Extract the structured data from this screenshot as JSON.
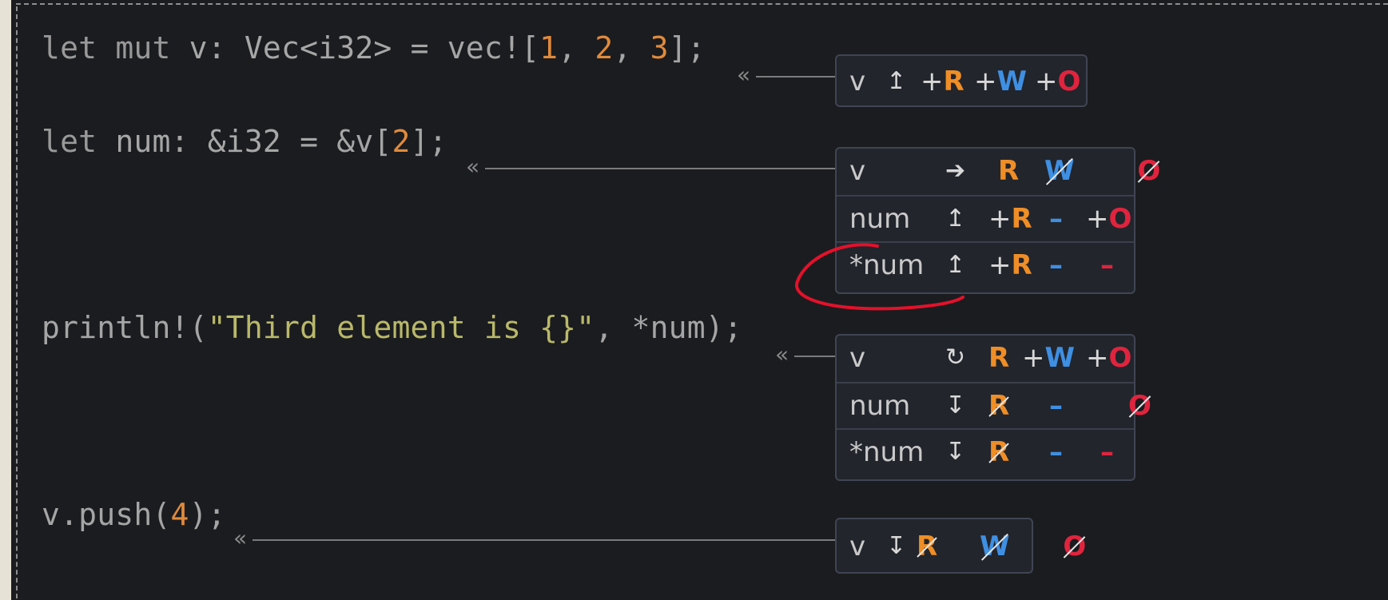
{
  "code": {
    "line1": {
      "kw1": "let",
      "kw2": "mut",
      "name": "v",
      "colon": ":",
      "type": "Vec<i32>",
      "eq": "=",
      "call": "vec!",
      "open": "[",
      "n1": "1",
      "c1": ",",
      "n2": "2",
      "c2": ",",
      "n3": "3",
      "close": "];"
    },
    "line2": {
      "kw1": "let",
      "name": "num",
      "colon": ":",
      "type": "&i32",
      "eq": "=",
      "expr_pre": "&v[",
      "idx": "2",
      "expr_post": "];"
    },
    "line3": {
      "call": "println!(",
      "str": "\"Third element is {}\"",
      "rest": ", *num);"
    },
    "line4": {
      "pre": "v.push(",
      "arg": "4",
      "post": ");"
    }
  },
  "permission_boxes": [
    {
      "rows": [
        {
          "path": "v",
          "action": "↥",
          "r": "+R",
          "w": "+W",
          "o": "+O"
        }
      ]
    },
    {
      "rows": [
        {
          "path": "v",
          "action": "➔",
          "r": "R",
          "w": "W",
          "o": "O"
        },
        {
          "path": "num",
          "action": "↥",
          "r": "+R",
          "w": "–",
          "o": "+O"
        },
        {
          "path": "*num",
          "action": "↥",
          "r": "+R",
          "w": "–",
          "o": "–"
        }
      ]
    },
    {
      "rows": [
        {
          "path": "v",
          "action": "↻",
          "r": "R",
          "w": "+W",
          "o": "+O"
        },
        {
          "path": "num",
          "action": "↧",
          "r": "R",
          "w": "–",
          "o": "O"
        },
        {
          "path": "*num",
          "action": "↧",
          "r": "R",
          "w": "–",
          "o": "–"
        }
      ]
    },
    {
      "rows": [
        {
          "path": "v",
          "action": "↧",
          "r": "R",
          "w": "W",
          "o": "O"
        }
      ]
    }
  ],
  "colors": {
    "background": "#1b1c1f",
    "read": "#ef8e26",
    "write": "#3f8fe2",
    "own": "#e0243e",
    "annotation_circle": "#e3112b"
  },
  "icons": {
    "connector": "double-chevron-left-icon",
    "gain": "arrow-up-icon",
    "move": "arrow-right-icon",
    "regain": "cycle-icon",
    "lose": "arrow-down-icon"
  }
}
